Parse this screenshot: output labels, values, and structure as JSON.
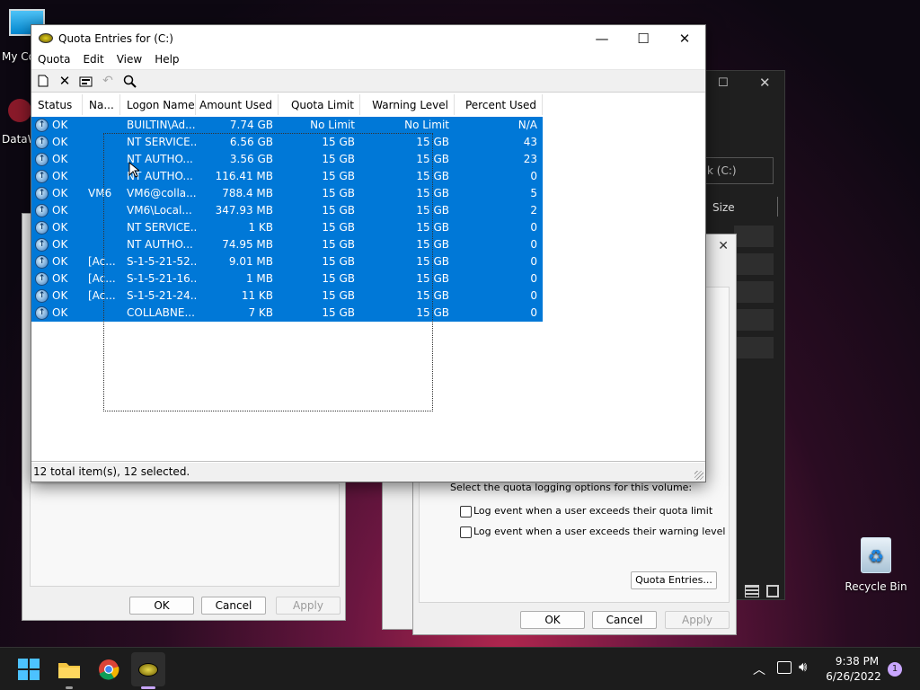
{
  "desktop": {
    "icons": [
      {
        "label": "My Co"
      },
      {
        "label": "DataW"
      },
      {
        "label": "Recycle Bin"
      }
    ]
  },
  "window": {
    "title": "Quota Entries for  (C:)",
    "controls": {
      "minimize": "—",
      "maximize": "☐",
      "close": "✕"
    },
    "menu": [
      "Quota",
      "Edit",
      "View",
      "Help"
    ],
    "toolbar_icons": [
      "new-entry-icon",
      "delete-icon",
      "properties-icon",
      "undo-icon",
      "find-icon"
    ],
    "columns": [
      "Status",
      "Na...",
      "Logon Name",
      "Amount Used",
      "Quota Limit",
      "Warning Level",
      "Percent Used"
    ],
    "rows": [
      {
        "status": "OK",
        "name": "",
        "logon": "BUILTIN\\Ad...",
        "used": "7.74 GB",
        "limit": "No Limit",
        "warning": "No Limit",
        "percent": "N/A"
      },
      {
        "status": "OK",
        "name": "",
        "logon": "NT SERVICE...",
        "used": "6.56 GB",
        "limit": "15 GB",
        "warning": "15 GB",
        "percent": "43"
      },
      {
        "status": "OK",
        "name": "",
        "logon": "NT AUTHO...",
        "used": "3.56 GB",
        "limit": "15 GB",
        "warning": "15 GB",
        "percent": "23"
      },
      {
        "status": "OK",
        "name": "",
        "logon": "NT AUTHO...",
        "used": "116.41 MB",
        "limit": "15 GB",
        "warning": "15 GB",
        "percent": "0"
      },
      {
        "status": "OK",
        "name": "VM6",
        "logon": "VM6@colla...",
        "used": "788.4 MB",
        "limit": "15 GB",
        "warning": "15 GB",
        "percent": "5"
      },
      {
        "status": "OK",
        "name": "",
        "logon": "VM6\\Local...",
        "used": "347.93 MB",
        "limit": "15 GB",
        "warning": "15 GB",
        "percent": "2"
      },
      {
        "status": "OK",
        "name": "",
        "logon": "NT SERVICE...",
        "used": "1 KB",
        "limit": "15 GB",
        "warning": "15 GB",
        "percent": "0"
      },
      {
        "status": "OK",
        "name": "",
        "logon": "NT AUTHO...",
        "used": "74.95 MB",
        "limit": "15 GB",
        "warning": "15 GB",
        "percent": "0"
      },
      {
        "status": "OK",
        "name": "[Ac...",
        "logon": "S-1-5-21-52...",
        "used": "9.01 MB",
        "limit": "15 GB",
        "warning": "15 GB",
        "percent": "0"
      },
      {
        "status": "OK",
        "name": "[Ac...",
        "logon": "S-1-5-21-16...",
        "used": "1 MB",
        "limit": "15 GB",
        "warning": "15 GB",
        "percent": "0"
      },
      {
        "status": "OK",
        "name": "[Ac...",
        "logon": "S-1-5-21-24...",
        "used": "11 KB",
        "limit": "15 GB",
        "warning": "15 GB",
        "percent": "0"
      },
      {
        "status": "OK",
        "name": "",
        "logon": "COLLABNE...",
        "used": "7 KB",
        "limit": "15 GB",
        "warning": "15 GB",
        "percent": "0"
      }
    ],
    "status": "12 total item(s), 12 selected."
  },
  "background_explorer": {
    "path_fragment": "k (C:)",
    "column": "Size"
  },
  "dialog_left": {
    "ok": "OK",
    "cancel": "Cancel",
    "apply": "Apply"
  },
  "dialog_right": {
    "logging_prompt": "Select the quota logging options for this volume:",
    "log_quota": "Log event when a user exceeds their quota limit",
    "log_warning": "Log event when a user exceeds their warning level",
    "quota_entries_button": "Quota Entries...",
    "ok": "OK",
    "cancel": "Cancel",
    "apply": "Apply"
  },
  "taskbar": {
    "time": "9:38 PM",
    "date": "6/26/2022",
    "notification_count": "1"
  },
  "colors": {
    "selection": "#0078d7",
    "taskbar": "#1c1c1c"
  }
}
